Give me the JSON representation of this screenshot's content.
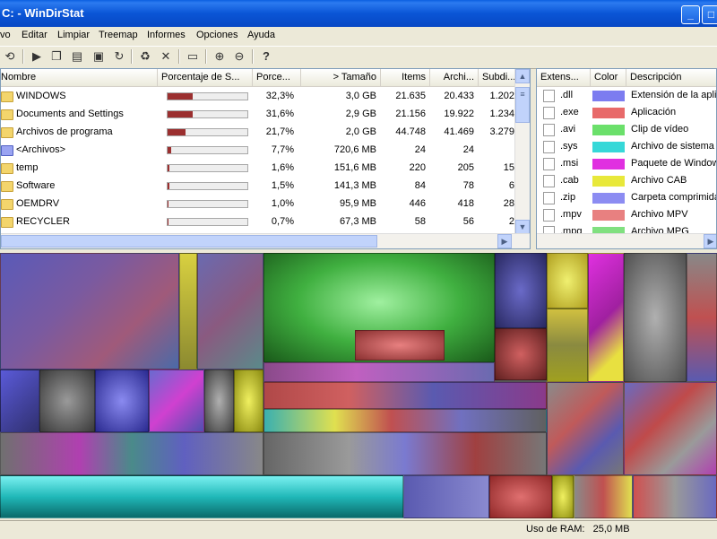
{
  "window": {
    "title": "C: - WinDirStat"
  },
  "menu": [
    "Archivo",
    "Editar",
    "Limpiar",
    "Treemap",
    "Informes",
    "Opciones",
    "Ayuda"
  ],
  "left_columns": [
    "Nombre",
    "Porcentaje de S...",
    "Porce...",
    "> Tamaño",
    "Items",
    "Archi...",
    "Subdi..."
  ],
  "left_rows": [
    {
      "name": "WINDOWS",
      "bar": 0.32,
      "pct": "32,3%",
      "size": "3,0 GB",
      "items": "21.635",
      "files": "20.433",
      "subdirs": "1.202",
      "icon": "folder"
    },
    {
      "name": "Documents and Settings",
      "bar": 0.32,
      "pct": "31,6%",
      "size": "2,9 GB",
      "items": "21.156",
      "files": "19.922",
      "subdirs": "1.234",
      "icon": "folder"
    },
    {
      "name": "Archivos de programa",
      "bar": 0.22,
      "pct": "21,7%",
      "size": "2,0 GB",
      "items": "44.748",
      "files": "41.469",
      "subdirs": "3.279",
      "icon": "folder"
    },
    {
      "name": "<Archivos>",
      "bar": 0.04,
      "pct": "7,7%",
      "size": "720,6 MB",
      "items": "24",
      "files": "24",
      "subdirs": "",
      "icon": "folder-blue"
    },
    {
      "name": "temp",
      "bar": 0.02,
      "pct": "1,6%",
      "size": "151,6 MB",
      "items": "220",
      "files": "205",
      "subdirs": "15",
      "icon": "folder"
    },
    {
      "name": "Software",
      "bar": 0.02,
      "pct": "1,5%",
      "size": "141,3 MB",
      "items": "84",
      "files": "78",
      "subdirs": "6",
      "icon": "folder"
    },
    {
      "name": "OEMDRV",
      "bar": 0.01,
      "pct": "1,0%",
      "size": "95,9 MB",
      "items": "446",
      "files": "418",
      "subdirs": "28",
      "icon": "folder"
    },
    {
      "name": "RECYCLER",
      "bar": 0.01,
      "pct": "0,7%",
      "size": "67,3 MB",
      "items": "58",
      "files": "56",
      "subdirs": "2",
      "icon": "folder"
    }
  ],
  "right_columns": [
    "Extens...",
    "Color",
    "Descripción"
  ],
  "extensions": [
    {
      "ext": ".dll",
      "color": "#7c7cf0",
      "desc": "Extensión de la aplicación"
    },
    {
      "ext": ".exe",
      "color": "#e86a6a",
      "desc": "Aplicación"
    },
    {
      "ext": ".avi",
      "color": "#6be06b",
      "desc": "Clip de vídeo"
    },
    {
      "ext": ".sys",
      "color": "#36d8d8",
      "desc": "Archivo de sistema"
    },
    {
      "ext": ".msi",
      "color": "#e030e0",
      "desc": "Paquete de Windows Installer"
    },
    {
      "ext": ".cab",
      "color": "#e8e83a",
      "desc": "Archivo CAB"
    },
    {
      "ext": ".zip",
      "color": "#8c8cf2",
      "desc": "Carpeta comprimida"
    },
    {
      "ext": ".mpv",
      "color": "#e88080",
      "desc": "Archivo MPV"
    },
    {
      "ext": ".mpg",
      "color": "#80e080",
      "desc": "Archivo MPG"
    }
  ],
  "status": {
    "ram_label": "Uso de RAM:",
    "ram_value": "25,0 MB"
  }
}
